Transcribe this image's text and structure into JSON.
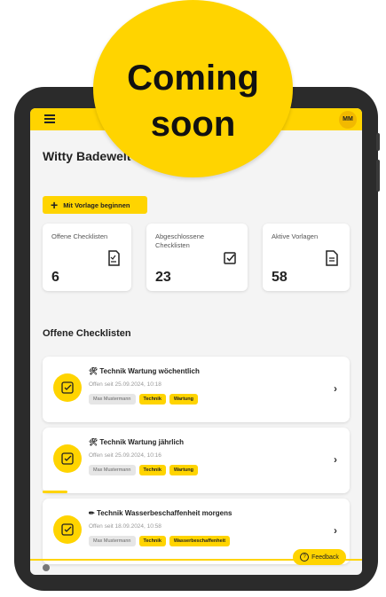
{
  "badge": {
    "line1": "Coming",
    "line2": "soon"
  },
  "header": {
    "avatar": "MM",
    "menu_icon": "hamburger-icon"
  },
  "page": {
    "title": "Witty Badewelt"
  },
  "actions": {
    "start_template": "Mit Vorlage beginnen"
  },
  "stats": [
    {
      "label": "Offene Checklisten",
      "value": "6",
      "icon": "checklist-icon"
    },
    {
      "label": "Abgeschlossene Checklisten",
      "value": "23",
      "icon": "checkbox-icon"
    },
    {
      "label": "Aktive Vorlagen",
      "value": "58",
      "icon": "document-icon"
    }
  ],
  "section": {
    "title": "Offene Checklisten"
  },
  "checklists": [
    {
      "emoji": "🛠",
      "title": "Technik Wartung wöchentlich",
      "date": "Offen seit 25.09.2024, 10:18",
      "user": "Max Mustermann",
      "tags": [
        "Technik",
        "Wartung"
      ],
      "progress": 0
    },
    {
      "emoji": "🛠",
      "title": "Technik Wartung jährlich",
      "date": "Offen seit 25.09.2024, 10:16",
      "user": "Max Mustermann",
      "tags": [
        "Technik",
        "Wartung"
      ],
      "progress": 0.08
    },
    {
      "emoji": "✏",
      "title": "Technik Wasserbeschaffenheit morgens",
      "date": "Offen seit 18.09.2024, 10:58",
      "user": "Max Mustermann",
      "tags": [
        "Technik",
        "Wasserbeschaffenheit"
      ],
      "progress": 0
    }
  ],
  "feedback": {
    "label": "Feedback"
  },
  "colors": {
    "accent": "#ffd400",
    "background": "#f4f4f4"
  }
}
